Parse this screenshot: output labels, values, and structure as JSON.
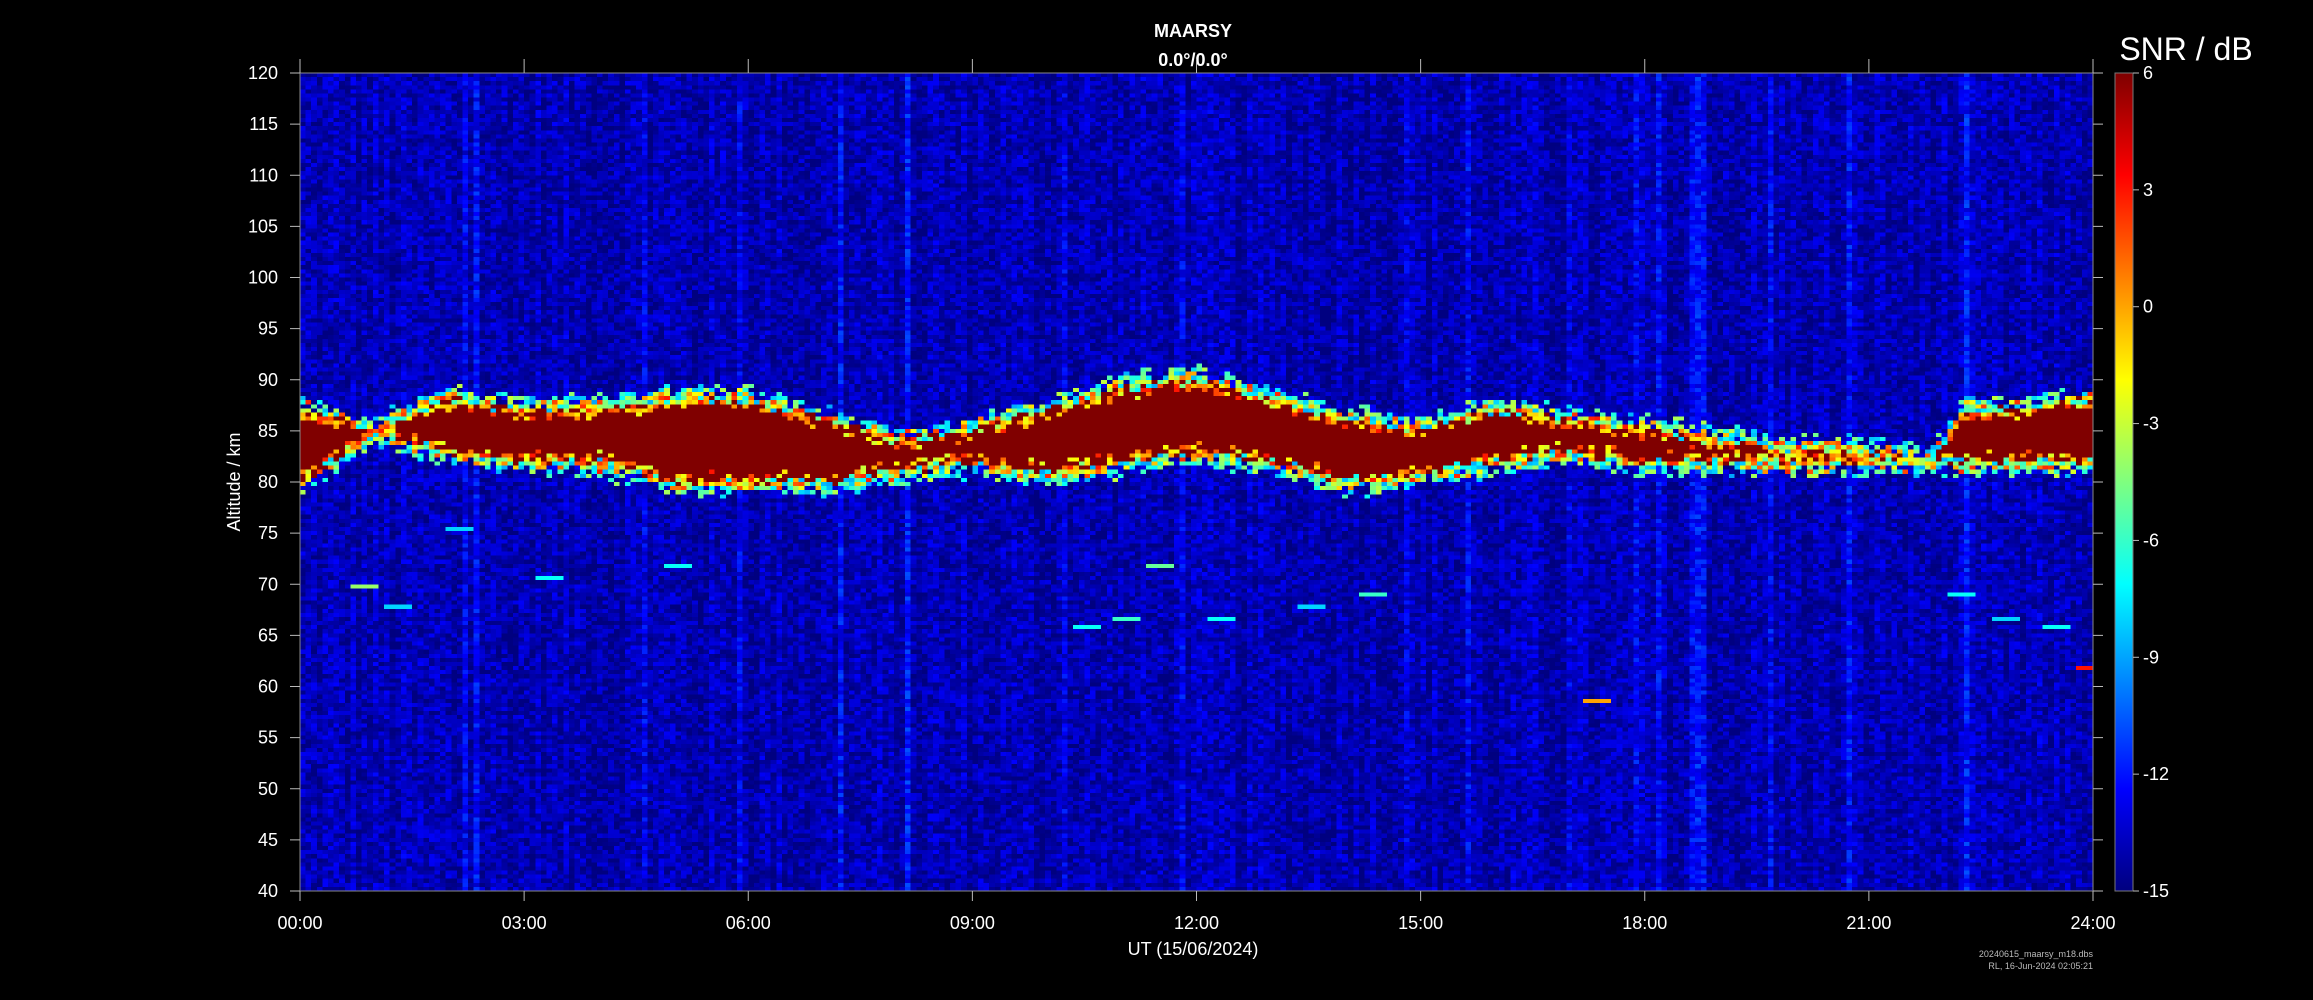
{
  "chart_data": {
    "type": "heatmap",
    "title": "MAARSY",
    "subtitle": "0.0°/0.0°",
    "xlabel": "UT (15/06/2024)",
    "ylabel": "Altitude / km",
    "x_range_hours": [
      0,
      24
    ],
    "x_ticks": [
      "00:00",
      "03:00",
      "06:00",
      "09:00",
      "12:00",
      "15:00",
      "18:00",
      "21:00",
      "24:00"
    ],
    "y_range_km": [
      40,
      120
    ],
    "y_ticks": [
      40,
      45,
      50,
      55,
      60,
      65,
      70,
      75,
      80,
      85,
      90,
      95,
      100,
      105,
      110,
      115,
      120
    ],
    "colorbar": {
      "label": "SNR / dB",
      "range_db": [
        -15,
        6
      ],
      "ticks": [
        6,
        3,
        0,
        -3,
        -6,
        -9,
        -12,
        -15
      ],
      "colormap": "jet",
      "placement": "right"
    },
    "background_level_db": -14,
    "main_echo_layer": {
      "description_points": [
        {
          "time_h": 0.0,
          "bottom_km": 79,
          "top_km": 88
        },
        {
          "time_h": 1.0,
          "bottom_km": 84,
          "top_km": 86
        },
        {
          "time_h": 2.0,
          "bottom_km": 82,
          "top_km": 89
        },
        {
          "time_h": 3.0,
          "bottom_km": 81,
          "top_km": 88
        },
        {
          "time_h": 4.0,
          "bottom_km": 81,
          "top_km": 88
        },
        {
          "time_h": 5.0,
          "bottom_km": 79,
          "top_km": 89
        },
        {
          "time_h": 6.0,
          "bottom_km": 79,
          "top_km": 89
        },
        {
          "time_h": 7.0,
          "bottom_km": 79,
          "top_km": 87
        },
        {
          "time_h": 8.0,
          "bottom_km": 80,
          "top_km": 85
        },
        {
          "time_h": 9.0,
          "bottom_km": 81,
          "top_km": 86
        },
        {
          "time_h": 10.0,
          "bottom_km": 80,
          "top_km": 88
        },
        {
          "time_h": 11.0,
          "bottom_km": 81,
          "top_km": 90
        },
        {
          "time_h": 12.0,
          "bottom_km": 82,
          "top_km": 91
        },
        {
          "time_h": 13.0,
          "bottom_km": 81,
          "top_km": 89
        },
        {
          "time_h": 14.0,
          "bottom_km": 79,
          "top_km": 87
        },
        {
          "time_h": 15.0,
          "bottom_km": 80,
          "top_km": 86
        },
        {
          "time_h": 16.0,
          "bottom_km": 81,
          "top_km": 88
        },
        {
          "time_h": 17.0,
          "bottom_km": 82,
          "top_km": 87
        },
        {
          "time_h": 18.0,
          "bottom_km": 81,
          "top_km": 86
        },
        {
          "time_h": 19.0,
          "bottom_km": 81,
          "top_km": 85
        },
        {
          "time_h": 20.0,
          "bottom_km": 81,
          "top_km": 84
        },
        {
          "time_h": 21.0,
          "bottom_km": 81,
          "top_km": 84
        },
        {
          "time_h": 21.8,
          "bottom_km": 81,
          "top_km": 83
        },
        {
          "time_h": 22.3,
          "bottom_km": 81,
          "top_km": 88
        },
        {
          "time_h": 23.0,
          "bottom_km": 81,
          "top_km": 88
        },
        {
          "time_h": 24.0,
          "bottom_km": 81,
          "top_km": 89
        }
      ],
      "peak_snr_db": 6
    },
    "sporadic_echoes": [
      {
        "time_h": 0.8,
        "alt_km": 70,
        "snr_db": -4
      },
      {
        "time_h": 1.3,
        "alt_km": 68,
        "snr_db": -8
      },
      {
        "time_h": 2.1,
        "alt_km": 75.5,
        "snr_db": -8
      },
      {
        "time_h": 3.3,
        "alt_km": 71,
        "snr_db": -7
      },
      {
        "time_h": 5.0,
        "alt_km": 72,
        "snr_db": -7
      },
      {
        "time_h": 10.5,
        "alt_km": 66,
        "snr_db": -7
      },
      {
        "time_h": 11.0,
        "alt_km": 67,
        "snr_db": -6
      },
      {
        "time_h": 11.5,
        "alt_km": 72,
        "snr_db": -5
      },
      {
        "time_h": 12.3,
        "alt_km": 67,
        "snr_db": -7
      },
      {
        "time_h": 13.5,
        "alt_km": 68,
        "snr_db": -8
      },
      {
        "time_h": 14.3,
        "alt_km": 69,
        "snr_db": -6
      },
      {
        "time_h": 17.3,
        "alt_km": 59,
        "snr_db": 0
      },
      {
        "time_h": 22.2,
        "alt_km": 69,
        "snr_db": -7
      },
      {
        "time_h": 22.8,
        "alt_km": 67,
        "snr_db": -8
      },
      {
        "time_h": 23.5,
        "alt_km": 66,
        "snr_db": -7
      },
      {
        "time_h": 23.9,
        "alt_km": 62,
        "snr_db": 3
      }
    ]
  },
  "footer": {
    "line1": "20240615_maarsy_m18.dbs",
    "line2": "RL, 16-Jun-2024 02:05:21"
  }
}
